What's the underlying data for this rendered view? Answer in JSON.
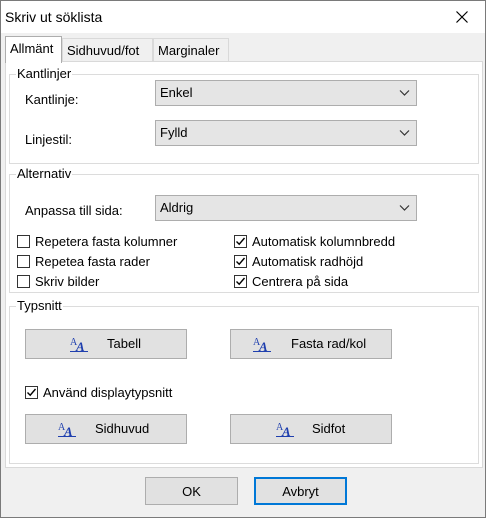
{
  "window": {
    "title": "Skriv ut söklista"
  },
  "tabs": [
    {
      "label": "Allmänt"
    },
    {
      "label": "Sidhuvud/fot"
    },
    {
      "label": "Marginaler"
    }
  ],
  "borders": {
    "title": "Kantlinjer",
    "border_label": "Kantlinje:",
    "border_value": "Enkel",
    "style_label": "Linjestil:",
    "style_value": "Fylld"
  },
  "options": {
    "title": "Alternativ",
    "fit_label": "Anpassa till sida:",
    "fit_value": "Aldrig",
    "checkboxes": [
      {
        "label": "Repetera fasta kolumner",
        "checked": false
      },
      {
        "label": "Repetea fasta rader",
        "checked": false
      },
      {
        "label": "Skriv bilder",
        "checked": false
      },
      {
        "label": "Automatisk kolumnbredd",
        "checked": true
      },
      {
        "label": "Automatisk radhöjd",
        "checked": true
      },
      {
        "label": "Centrera på sida",
        "checked": true
      }
    ]
  },
  "fonts": {
    "title": "Typsnitt",
    "table_btn": "Tabell",
    "fixed_btn": "Fasta rad/kol",
    "use_display": "Använd displaytypsnitt",
    "use_display_checked": true,
    "header_btn": "Sidhuvud",
    "footer_btn": "Sidfot"
  },
  "footer": {
    "ok": "OK",
    "cancel": "Avbryt"
  },
  "icons": {
    "font_icon": "font-icon",
    "close_icon": "close-icon",
    "dropdown_icon": "chevron-down-icon",
    "check_icon": "check-icon"
  },
  "colors": {
    "accent": "#0078d7",
    "icon_blue": "#1f3fae"
  }
}
